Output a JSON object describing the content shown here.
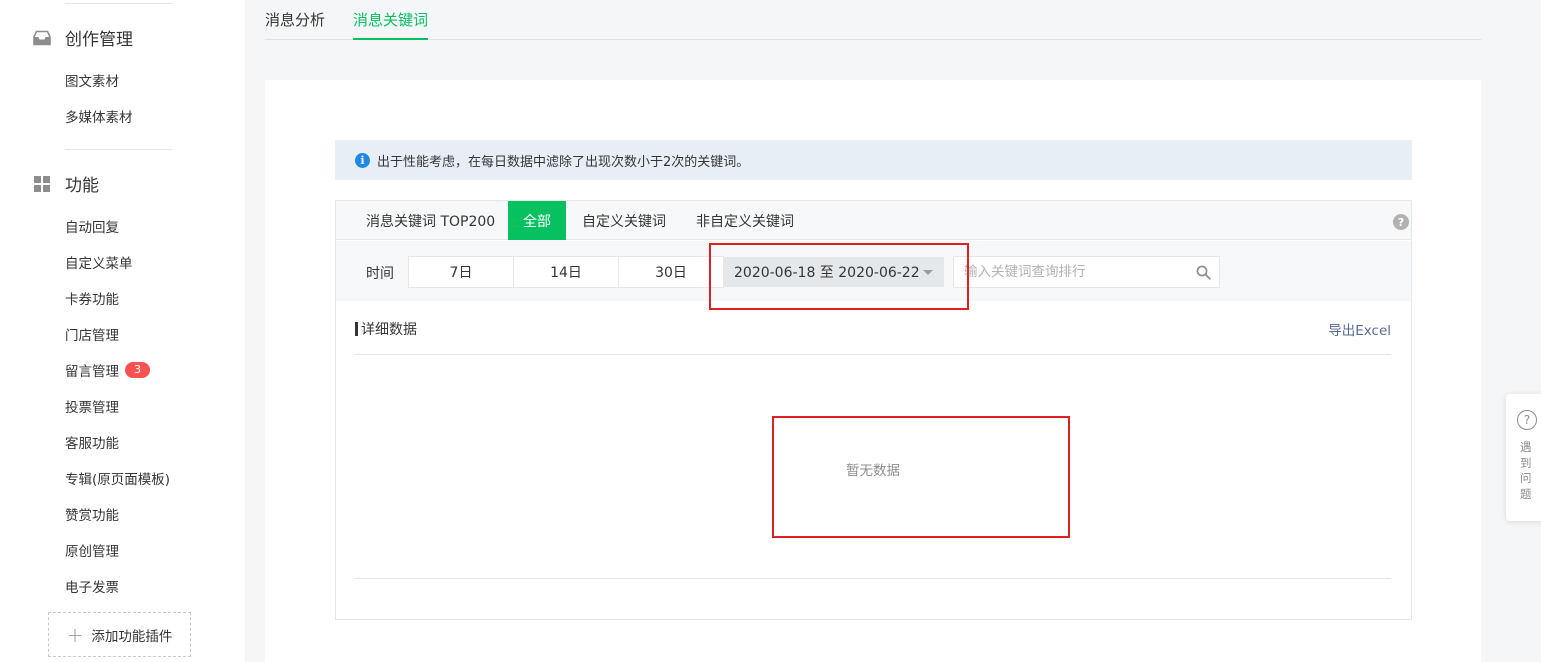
{
  "sidebar": {
    "section_create": {
      "label": "创作管理",
      "icon": "inbox-icon"
    },
    "create_items": [
      {
        "label": "图文素材"
      },
      {
        "label": "多媒体素材"
      }
    ],
    "section_features": {
      "label": "功能",
      "icon": "grid-icon"
    },
    "feature_items": [
      {
        "label": "自动回复"
      },
      {
        "label": "自定义菜单"
      },
      {
        "label": "卡券功能"
      },
      {
        "label": "门店管理"
      },
      {
        "label": "留言管理",
        "badge": "3"
      },
      {
        "label": "投票管理"
      },
      {
        "label": "客服功能"
      },
      {
        "label": "专辑(原页面模板)"
      },
      {
        "label": "赞赏功能"
      },
      {
        "label": "原创管理"
      },
      {
        "label": "电子发票"
      }
    ],
    "add_plugin": "添加功能插件"
  },
  "topnav": {
    "tabs": [
      {
        "label": "消息分析",
        "active": false
      },
      {
        "label": "消息关键词",
        "active": true
      }
    ]
  },
  "notice": {
    "icon": "info-icon",
    "text": "出于性能考虑，在每日数据中滤除了出现次数小于2次的关键词。"
  },
  "panel": {
    "tabs": [
      {
        "label": "消息关键词 TOP200"
      },
      {
        "label": "全部",
        "active": true
      },
      {
        "label": "自定义关键词"
      },
      {
        "label": "非自定义关键词"
      }
    ],
    "help_icon": "?",
    "time_label": "时间",
    "segments": [
      "7日",
      "14日",
      "30日"
    ],
    "date_range": "2020-06-18 至 2020-06-22",
    "search_placeholder": "输入关键词查询排行",
    "detail_title": "详细数据",
    "export_label": "导出Excel",
    "empty_text": "暂无数据"
  },
  "float_help": {
    "icon": "?",
    "text": "遇到问题"
  },
  "colors": {
    "accent": "#07c160",
    "badge": "#fa5151",
    "link": "#576b95",
    "annotation": "#e02020"
  }
}
